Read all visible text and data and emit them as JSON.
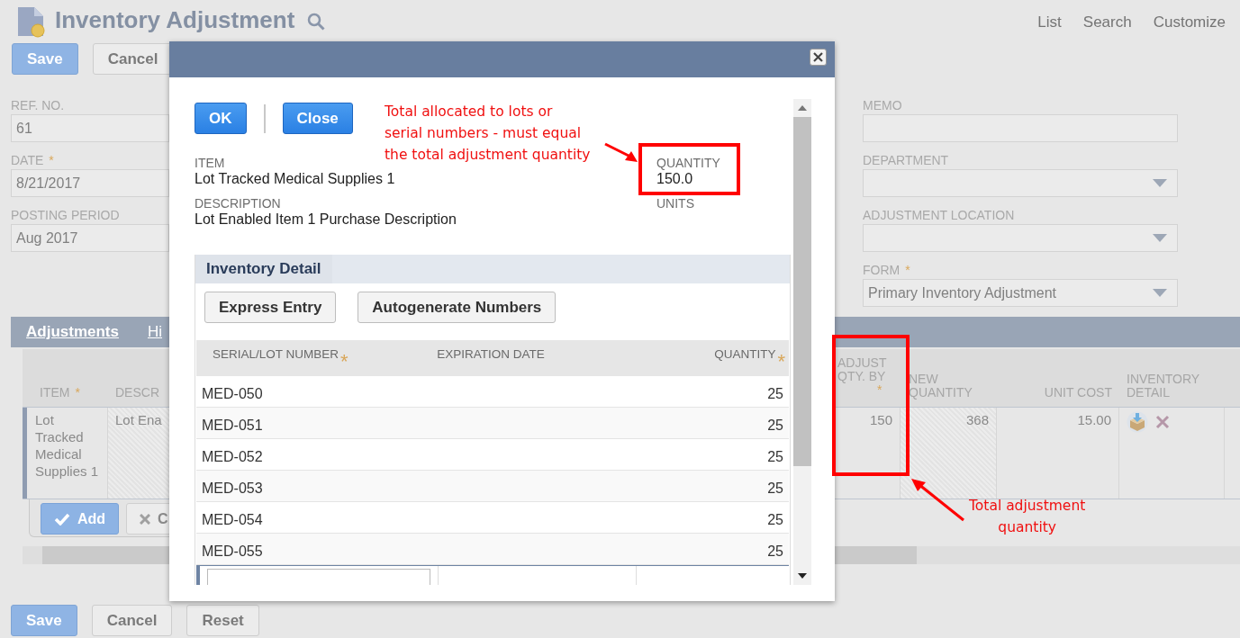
{
  "header": {
    "title": "Inventory Adjustment",
    "links": [
      "List",
      "Search",
      "Customize"
    ]
  },
  "top_buttons": [
    {
      "label": "Save",
      "kind": "primary"
    },
    {
      "label": "Cancel",
      "kind": "secondary"
    }
  ],
  "fields_left": [
    {
      "label": "REF. NO.",
      "value": "61"
    },
    {
      "label": "DATE",
      "required_mark": "*",
      "value": "8/21/2017"
    },
    {
      "label": "POSTING PERIOD",
      "value": "Aug 2017"
    }
  ],
  "fields_right": [
    {
      "label": "MEMO",
      "kind": "text"
    },
    {
      "label": "DEPARTMENT",
      "kind": "select"
    },
    {
      "label": "ADJUSTMENT LOCATION",
      "kind": "select"
    },
    {
      "label": "FORM",
      "required_mark": "*",
      "kind": "select",
      "value": "Primary Inventory Adjustment"
    }
  ],
  "subtabs": [
    {
      "label": "Adjustments",
      "selected": true
    },
    {
      "label": "Hi",
      "selected": false
    }
  ],
  "sublist": {
    "columns_left": [
      {
        "label": "ITEM",
        "required_mark": "*"
      },
      {
        "label": "DESCR"
      }
    ],
    "columns_right": [
      {
        "label": "ADJUST QTY. BY",
        "required_mark": "*"
      },
      {
        "label": "NEW QUANTITY"
      },
      {
        "label": "UNIT COST"
      },
      {
        "label": "INVENTORY DETAIL"
      }
    ],
    "row": {
      "item": "Lot Tracked Medical Supplies 1",
      "description": "Lot Ena",
      "adjust_qty": "150",
      "new_quantity": "368",
      "unit_cost": "15.00"
    },
    "line_buttons": [
      {
        "label": "Add",
        "kind": "add"
      },
      {
        "label": "C",
        "kind": "cancel"
      }
    ]
  },
  "bottom_buttons": [
    {
      "label": "Save",
      "kind": "primary"
    },
    {
      "label": "Cancel",
      "kind": "secondary"
    },
    {
      "label": "Reset",
      "kind": "secondary"
    }
  ],
  "dialog": {
    "buttons": [
      {
        "label": "OK"
      },
      {
        "label": "Close"
      }
    ],
    "item_label": "ITEM",
    "item": "Lot Tracked Medical Supplies 1",
    "description_label": "DESCRIPTION",
    "description": "Lot Enabled Item 1 Purchase Description",
    "quantity_label": "QUANTITY",
    "quantity": "150.0",
    "units_label": "UNITS",
    "detail_tab": "Inventory Detail",
    "detail_buttons": [
      "Express Entry",
      "Autogenerate Numbers"
    ],
    "columns": [
      {
        "label": "SERIAL/LOT NUMBER",
        "required_mark": "*"
      },
      {
        "label": "EXPIRATION DATE"
      },
      {
        "label": "QUANTITY",
        "required_mark": "*"
      }
    ],
    "rows": [
      {
        "number": "MED-050",
        "quantity": "25"
      },
      {
        "number": "MED-051",
        "quantity": "25"
      },
      {
        "number": "MED-052",
        "quantity": "25"
      },
      {
        "number": "MED-053",
        "quantity": "25"
      },
      {
        "number": "MED-054",
        "quantity": "25"
      },
      {
        "number": "MED-055",
        "quantity": "25"
      }
    ]
  },
  "annotations": [
    {
      "kind": "quantity-callout",
      "text": "Total allocated to lots or\nserial numbers - must equal\nthe total adjustment quantity"
    },
    {
      "kind": "adjust-callout",
      "text": "Total adjustment\nquantity"
    }
  ]
}
